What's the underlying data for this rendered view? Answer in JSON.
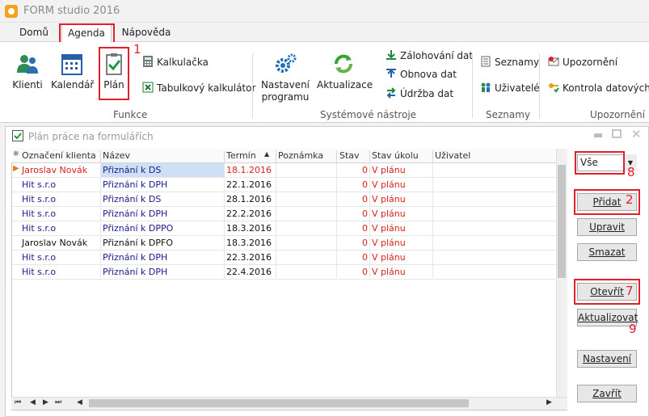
{
  "app": {
    "title": "FORM studio 2016"
  },
  "menu": {
    "tabs": [
      "Domů",
      "Agenda",
      "Nápověda"
    ]
  },
  "ribbon": {
    "funkce": {
      "klienti": "Klienti",
      "kalendar": "Kalendář",
      "plan": "Plán",
      "kalkulacka": "Kalkulačka",
      "tabulkovy": "Tabulkový kalkulátor",
      "group": "Funkce"
    },
    "system": {
      "nastaveni_line1": "Nastavení",
      "nastaveni_line2": "programu",
      "aktualizace": "Aktualizace",
      "zalohovani": "Zálohování dat",
      "obnova": "Obnova dat",
      "udrzba": "Údržba dat",
      "group": "Systémové nástroje"
    },
    "seznamy": {
      "seznamy": "Seznamy",
      "uzivatele": "Uživatelé",
      "group": "Seznamy"
    },
    "upozorneni": {
      "upozorneni": "Upozornění",
      "kontrola": "Kontrola datových sc",
      "group": "Upozornění"
    }
  },
  "annotations": [
    "1",
    "2",
    "7",
    "8",
    "9"
  ],
  "window": {
    "title": "Plán práce na formulářích"
  },
  "grid": {
    "columns": [
      "Označení klienta",
      "Název",
      "Termín",
      "Poznámka",
      "Stav",
      "Stav úkolu",
      "Uživatel"
    ],
    "rows": [
      {
        "klient": "Jaroslav Novák",
        "nazev": "Přiznání k DS",
        "termin": "18.1.2016",
        "poznamka": "",
        "stav": "0",
        "stav_ukolu": "V plánu",
        "uzivatel": ""
      },
      {
        "klient": "Hit s.r.o",
        "nazev": "Přiznání k DPH",
        "termin": "22.1.2016",
        "poznamka": "",
        "stav": "0",
        "stav_ukolu": "V plánu",
        "uzivatel": ""
      },
      {
        "klient": "Hit s.r.o",
        "nazev": "Přiznání k DS",
        "termin": "28.1.2016",
        "poznamka": "",
        "stav": "0",
        "stav_ukolu": "V plánu",
        "uzivatel": ""
      },
      {
        "klient": "Hit s.r.o",
        "nazev": "Přiznání k DPH",
        "termin": "22.2.2016",
        "poznamka": "",
        "stav": "0",
        "stav_ukolu": "V plánu",
        "uzivatel": ""
      },
      {
        "klient": "Hit s.r.o",
        "nazev": "Přiznání k DPPO",
        "termin": "18.3.2016",
        "poznamka": "",
        "stav": "0",
        "stav_ukolu": "V plánu",
        "uzivatel": ""
      },
      {
        "klient": "Jaroslav Novák",
        "nazev": "Přiznání k DPFO",
        "termin": "18.3.2016",
        "poznamka": "",
        "stav": "0",
        "stav_ukolu": "V plánu",
        "uzivatel": ""
      },
      {
        "klient": "Hit s.r.o",
        "nazev": "Přiznání k DPH",
        "termin": "22.3.2016",
        "poznamka": "",
        "stav": "0",
        "stav_ukolu": "V plánu",
        "uzivatel": ""
      },
      {
        "klient": "Hit s.r.o",
        "nazev": "Přiznání k DPH",
        "termin": "22.4.2016",
        "poznamka": "",
        "stav": "0",
        "stav_ukolu": "V plánu",
        "uzivatel": ""
      }
    ]
  },
  "panel": {
    "filter_value": "Vše",
    "pridat": "Přidat",
    "upravit": "Upravit",
    "smazat": "Smazat",
    "otevrit": "Otevřít",
    "aktualizovat": "Aktualizovat",
    "nastaveni": "Nastavení",
    "zavrit": "Zavřít"
  },
  "colors": {
    "accent_red": "#e0202a",
    "overdue_red": "#d9221c",
    "navy": "#1a1a8c",
    "selected_row": "#cfe0f5"
  }
}
